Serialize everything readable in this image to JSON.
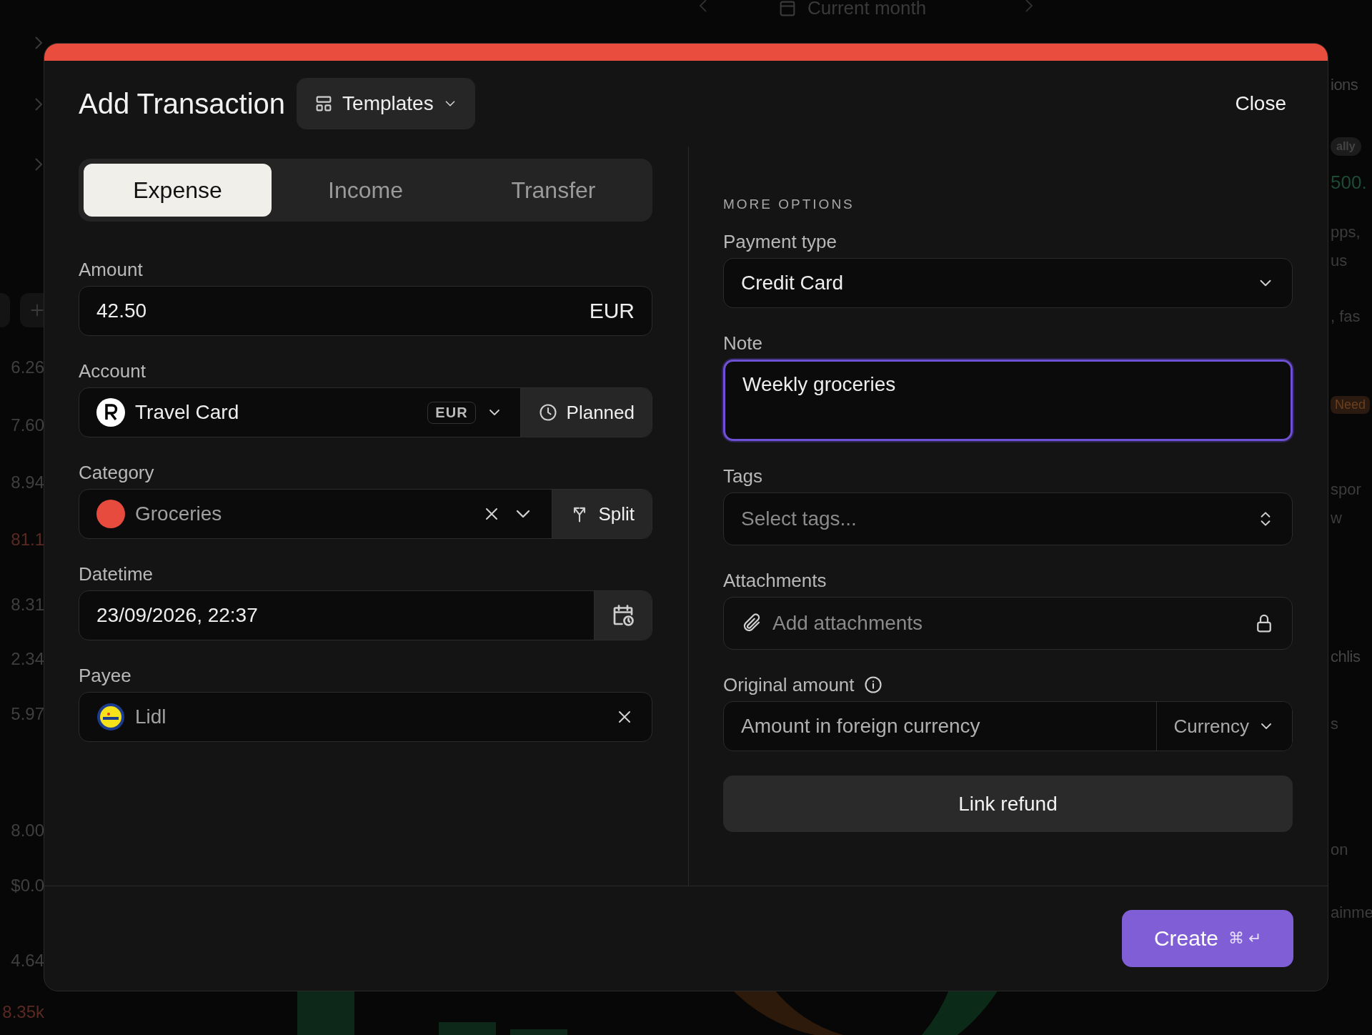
{
  "background": {
    "period_label": "Current month",
    "left_values": [
      {
        "text": "6.26",
        "negative": false
      },
      {
        "text": "7.60",
        "negative": false
      },
      {
        "text": "8.94",
        "negative": false
      },
      {
        "text": "81.1",
        "negative": true
      },
      {
        "text": "8.31",
        "negative": false
      },
      {
        "text": "2.34",
        "negative": false
      },
      {
        "text": "5.97",
        "negative": false
      },
      {
        "text": "8.00",
        "negative": false
      },
      {
        "text": "$0.0",
        "negative": false
      },
      {
        "text": "4.64",
        "negative": false
      },
      {
        "text": "8.35k",
        "negative": true
      }
    ],
    "right_texts": [
      {
        "text": "ions",
        "kind": "heading"
      },
      {
        "text": "ally",
        "kind": "chip"
      },
      {
        "text": "500.",
        "kind": "positive"
      },
      {
        "text": "pps,",
        "kind": "plain"
      },
      {
        "text": "us",
        "kind": "plain"
      },
      {
        "text": ", fas",
        "kind": "plain"
      },
      {
        "text": "Need",
        "kind": "badge"
      },
      {
        "text": "spor",
        "kind": "plain"
      },
      {
        "text": "w",
        "kind": "plain"
      },
      {
        "text": "chlis",
        "kind": "heading"
      },
      {
        "text": "s",
        "kind": "plain"
      },
      {
        "text": "on",
        "kind": "plain"
      },
      {
        "text": "ainme",
        "kind": "plain"
      }
    ]
  },
  "dialog": {
    "title": "Add Transaction",
    "templates_button": "Templates",
    "close_button": "Close",
    "type_tabs": [
      {
        "label": "Expense",
        "selected": true
      },
      {
        "label": "Income",
        "selected": false
      },
      {
        "label": "Transfer",
        "selected": false
      }
    ],
    "amount": {
      "label": "Amount",
      "value": "42.50",
      "currency": "EUR"
    },
    "account": {
      "label": "Account",
      "value": "Travel Card",
      "currency": "EUR",
      "planned_button": "Planned"
    },
    "category": {
      "label": "Category",
      "value": "Groceries",
      "color": "#e64b3e",
      "split_button": "Split"
    },
    "datetime": {
      "label": "Datetime",
      "value": "23/09/2026, 22:37"
    },
    "payee": {
      "label": "Payee",
      "value": "Lidl"
    },
    "more_options": {
      "heading": "MORE OPTIONS",
      "payment_type": {
        "label": "Payment type",
        "value": "Credit Card"
      },
      "note": {
        "label": "Note",
        "value": "Weekly groceries",
        "focused": true
      },
      "tags": {
        "label": "Tags",
        "placeholder": "Select tags..."
      },
      "attachments": {
        "label": "Attachments",
        "placeholder": "Add attachments"
      },
      "original_amount": {
        "label": "Original amount",
        "placeholder": "Amount in foreign currency",
        "currency_placeholder": "Currency"
      },
      "link_refund_button": "Link refund"
    },
    "create_button": {
      "label": "Create",
      "shortcut": [
        "⌘",
        "↵"
      ]
    }
  }
}
